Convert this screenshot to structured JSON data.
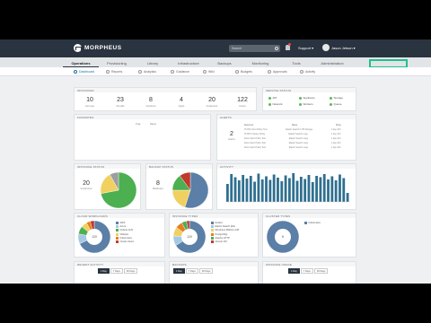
{
  "app": {
    "name": "MORPHEUS"
  },
  "header": {
    "search_placeholder": "Search",
    "support_label": "Support ▾",
    "user_label": "Jason Jetson ▾"
  },
  "main_nav": [
    "Operations",
    "Provisioning",
    "Library",
    "Infrastructure",
    "Backups",
    "Monitoring",
    "Tools",
    "Administration"
  ],
  "sub_nav": [
    "Dashboard",
    "Reports",
    "Analytics",
    "Guidance",
    "Wiki",
    "Budgets",
    "Approvals",
    "Activity"
  ],
  "instances": {
    "title": "Instances",
    "stats": [
      {
        "value": "10",
        "label": "Groups"
      },
      {
        "value": "23",
        "label": "Clouds"
      },
      {
        "value": "8",
        "label": "Clusters"
      },
      {
        "value": "4",
        "label": "Apps"
      },
      {
        "value": "20",
        "label": "Instances"
      },
      {
        "value": "122",
        "label": "Users"
      }
    ]
  },
  "service_status": {
    "title": "Service Status",
    "items": [
      "API",
      "Appliance",
      "Storage",
      "Network",
      "Workers",
      "Queue"
    ]
  },
  "favorites": {
    "title": "Favorites",
    "col_type": "Type",
    "col_name": "Name"
  },
  "alerts": {
    "title": "Alerts",
    "count": "2",
    "count_label": "Alerts",
    "headers": [
      "Resource",
      "Name",
      "Since"
    ],
    "rows": [
      [
        "Hi CPU Alert Policy Test",
        "Elastic Search 1 TB Storage",
        "1 day 10 h"
      ],
      [
        "Hi CPU Cluster Policy",
        "Elastic Search Logs",
        "1 day 10 h"
      ],
      [
        "Demo Alert Policy Test",
        "Elastic Search Logs",
        "1 day 10 h"
      ],
      [
        "Demo Alert Policy Test",
        "Elastic Search Logs",
        "1 day 10 h"
      ],
      [
        "Demo Alert Policy Test",
        "Elastic Search Logs",
        "1 day 10 h"
      ]
    ]
  },
  "instance_status": {
    "title": "Instance Status",
    "count": "20",
    "count_label": "Instances",
    "slices": [
      0.72,
      0.2,
      0.08
    ],
    "colors": [
      "#4caf50",
      "#f0d060",
      "#9e9e9e"
    ]
  },
  "backup_status": {
    "title": "Backup Status",
    "count": "8",
    "count_label": "Backups",
    "slices": [
      0.55,
      0.2,
      0.15,
      0.1
    ],
    "colors": [
      "#5b7fa6",
      "#f0d060",
      "#4caf50",
      "#c0392b"
    ]
  },
  "activity": {
    "title": "Activity",
    "values": [
      40,
      62,
      55,
      48,
      60,
      52,
      58,
      45,
      63,
      50,
      57,
      49,
      61,
      54,
      46,
      59,
      53,
      64,
      47,
      56,
      51,
      60,
      44,
      58,
      55,
      62,
      50,
      57,
      48,
      61,
      53,
      20
    ]
  },
  "cloud_types": {
    "title": "Cloud Workloads",
    "center": "120",
    "legend": [
      "AWS",
      "Azure",
      "Nutanix AHV",
      "VMware",
      "Kubernetes",
      "Oracle Cloud"
    ],
    "slices": [
      0.68,
      0.1,
      0.08,
      0.06,
      0.04,
      0.04
    ],
    "colors": [
      "#5b7fa6",
      "#a5c8e4",
      "#4caf50",
      "#f0d060",
      "#e67e22",
      "#c0392b"
    ]
  },
  "instance_types": {
    "title": "Instance Types",
    "center": "120",
    "legend": [
      "Docker",
      "Elastic Search (ES)",
      "Morpheus Platform API",
      "PostgreSQL",
      "Apache HTTP",
      "Ubuntu VM"
    ],
    "slices": [
      0.66,
      0.1,
      0.09,
      0.07,
      0.05,
      0.03
    ],
    "colors": [
      "#5b7fa6",
      "#a5c8e4",
      "#f0d060",
      "#e67e22",
      "#4caf50",
      "#c0392b"
    ]
  },
  "cluster_types": {
    "title": "Cluster Types",
    "center": "8",
    "legend": [
      "Kubernetes"
    ],
    "slices": [
      1.0
    ],
    "colors": [
      "#5b7fa6"
    ]
  },
  "bottom": {
    "titles": [
      "Recent Activity",
      "Backups",
      "Instance Usage"
    ],
    "tabs": [
      [
        "1 Day",
        "7 Days",
        "30 Days"
      ],
      [
        "1 Day",
        "7 Days",
        "30 Days"
      ],
      [
        "1 Day",
        "7 Days",
        "30 Days"
      ]
    ]
  }
}
